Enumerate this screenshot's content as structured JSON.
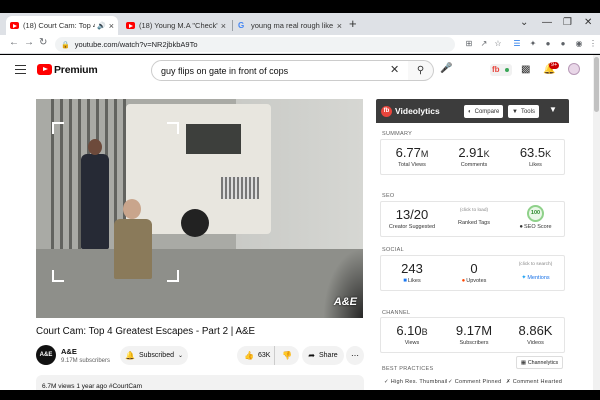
{
  "browser": {
    "tabs": [
      {
        "label": "(18) Court Cam: Top 4 Greate",
        "icon": "youtube-icon",
        "audio": true,
        "active": true
      },
      {
        "label": "(18) Young M.A \"Check\" Freestyle",
        "icon": "youtube-icon",
        "active": false
      },
      {
        "label": "young ma real rough like beards",
        "icon": "google-icon",
        "active": false
      }
    ],
    "url": "youtube.com/watch?v=NR2jbkbA9To",
    "colors": {
      "tabbar": "#dee1e6",
      "active_tab": "#ffffff"
    }
  },
  "youtube": {
    "brand": "Premium",
    "search_query": "guy flips on gate in front of cops",
    "notification_count": "9+",
    "video": {
      "title": "Court Cam: Top 4 Greatest Escapes - Part 2 | A&E",
      "watermark": "A&E",
      "channel": {
        "name": "A&E",
        "avatar_text": "A&E",
        "subscribers": "9.17M subscribers"
      },
      "subscribed_label": "Subscribed",
      "likes": "63K",
      "share_label": "Share",
      "views_line": "6.7M views  1 year ago  #CourtCam"
    }
  },
  "videolytics": {
    "title": "Videolytics",
    "compare_label": "Compare",
    "tools_label": "Tools",
    "summary": {
      "heading": "SUMMARY",
      "total_views": {
        "value": "6.77",
        "unit": "M",
        "label": "Total Views"
      },
      "comments": {
        "value": "2.91",
        "unit": "K",
        "label": "Comments"
      },
      "likes": {
        "value": "63.5",
        "unit": "K",
        "label": "Likes"
      }
    },
    "seo": {
      "heading": "SEO",
      "creator_suggested": {
        "value": "13/20",
        "label": "Creator Suggested"
      },
      "ranked_tags": {
        "hint": "(click to load)",
        "label": "Ranked Tags"
      },
      "seo_score": {
        "value": "100",
        "label": "SEO Score"
      }
    },
    "social": {
      "heading": "SOCIAL",
      "likes": {
        "value": "243",
        "label": "Likes"
      },
      "upvotes": {
        "value": "0",
        "label": "Upvotes"
      },
      "mentions": {
        "hint": "(click to search)",
        "label": "Mentions"
      }
    },
    "channel": {
      "heading": "CHANNEL",
      "channelytics_label": "Channelytics",
      "views": {
        "value": "6.10",
        "unit": "B",
        "label": "Views"
      },
      "subscribers": {
        "value": "9.17M",
        "label": "Subscribers"
      },
      "videos": {
        "value": "8.86K",
        "label": "Videos"
      }
    },
    "best_practices": {
      "heading": "BEST PRACTICES",
      "items": [
        "✓ High Res. Thumbnail",
        "✓ Comment Pinned",
        "✗ Comment Hearted"
      ]
    },
    "colors": {
      "header": "#3c3c3c",
      "logo": "#e8453c",
      "score_ring": "#8fd18a"
    }
  }
}
